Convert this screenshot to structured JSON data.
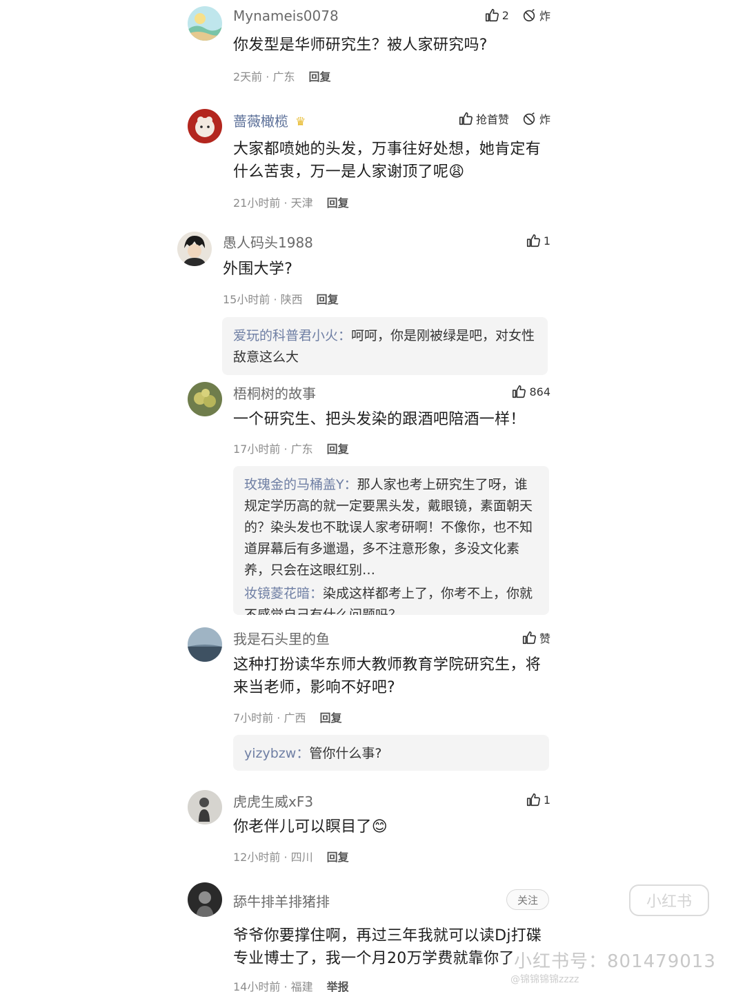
{
  "comments": [
    {
      "username": "Mynameis0078",
      "text": "你发型是华师研究生？被人家研究吗?",
      "time": "2天前",
      "location": "广东",
      "reply_label": "回复",
      "like_count": "2",
      "extra_action": "炸"
    },
    {
      "username": "蔷薇橄榄",
      "badge": "♛",
      "text": "大家都喷她的头发，万事往好处想，她肯定有什么苦衷，万一是人家谢顶了呢😩",
      "time": "21小时前",
      "location": "天津",
      "reply_label": "回复",
      "like_count": "抢首赞",
      "extra_action": "炸"
    },
    {
      "username": "愚人码头1988",
      "text": "外围大学?",
      "time": "15小时前",
      "location": "陕西",
      "reply_label": "回复",
      "like_count": "1",
      "replies": [
        {
          "name": "爱玩的科普君小火：",
          "text": "呵呵，你是刚被绿是吧，对女性敌意这么大"
        }
      ]
    },
    {
      "username": "梧桐树的故事",
      "text": "一个研究生、把头发染的跟酒吧陪酒一样！",
      "time": "17小时前",
      "location": "广东",
      "reply_label": "回复",
      "like_count": "864",
      "replies": [
        {
          "name": "玫瑰金的马桶盖Y：",
          "text": "那人家也考上研究生了呀，谁规定学历高的就一定要黑头发，戴眼镜，素面朝天的？染头发也不耽误人家考研啊！不像你，也不知道屏幕后有多邋遢，多不注意形象，多没文化素养，只会在这眼红别…"
        },
        {
          "name": "妆镜菱花暗：",
          "text": "染成这样都考上了，你考不上，你就不感觉自己有什么问题吗？"
        }
      ]
    },
    {
      "username": "我是石头里的鱼",
      "text": "这种打扮读华东师大教师教育学院研究生，将来当老师，影响不好吧?",
      "time": "7小时前",
      "location": "广西",
      "reply_label": "回复",
      "like_count": "赞",
      "replies": [
        {
          "name": "yizybzw：",
          "text": "管你什么事?"
        }
      ]
    },
    {
      "username": "虎虎生威xF3",
      "text": "你老伴儿可以瞑目了😊",
      "time": "12小时前",
      "location": "四川",
      "reply_label": "回复",
      "like_count": "1"
    },
    {
      "username": "舔牛排羊排猪排",
      "follow_label": "关注",
      "text": "爷爷你要撑住啊，再过三年我就可以读Dj打碟专业博士了，我一个月20万学费就靠你了",
      "time": "14小时前",
      "location": "福建",
      "reply_label": "举报"
    }
  ],
  "separator": " · ",
  "watermark": {
    "logo": "小红书",
    "id": "小红书号：801479013",
    "weibo": "@锦锦锦锦zzzz"
  },
  "colors": {
    "username": "#6a6a6a",
    "vip_username": "#5b6f98",
    "reply_name": "#6f7fa4",
    "reply_bg": "#f4f4f4",
    "meta": "#8c8c8c"
  },
  "icons": [
    "thumbs-up-icon",
    "no-bomb-icon",
    "crown-icon"
  ]
}
